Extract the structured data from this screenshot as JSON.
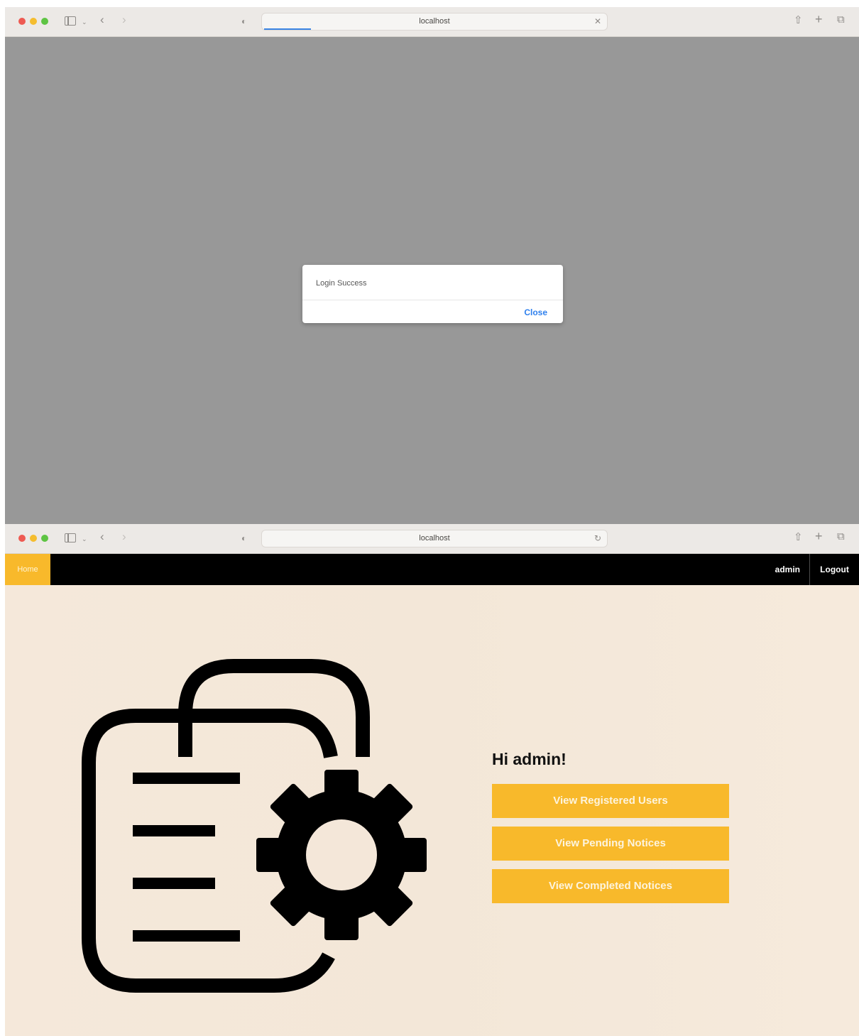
{
  "window1": {
    "address": "localhost",
    "dialog": {
      "message": "Login Success",
      "close_label": "Close"
    }
  },
  "window2": {
    "address": "localhost",
    "nav": {
      "home_label": "Home",
      "username": "admin",
      "logout_label": "Logout"
    },
    "greeting": "Hi admin!",
    "buttons": {
      "registered_users": "View Registered Users",
      "pending_notices": "View Pending Notices",
      "completed_notices": "View Completed Notices"
    }
  },
  "colors": {
    "accent": "#f8b92b",
    "navbar": "#000000",
    "overlay": "#989898",
    "link": "#2f80ed",
    "page_bg": "#f5e8da"
  },
  "icons": [
    "sidebar-icon",
    "chevron-down-icon",
    "back-icon",
    "forward-icon",
    "shield-icon",
    "close-icon",
    "reload-icon",
    "share-icon",
    "plus-icon",
    "tabs-icon",
    "document-gear-icon"
  ]
}
